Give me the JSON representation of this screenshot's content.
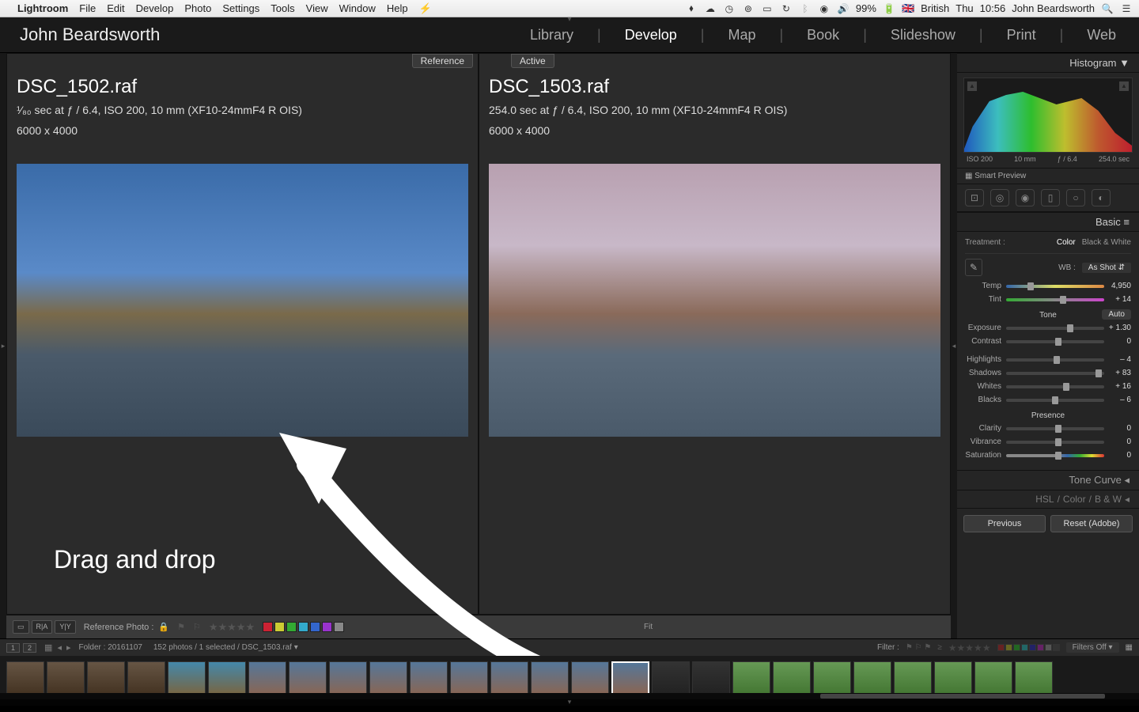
{
  "menubar": {
    "app": "Lightroom",
    "items": [
      "File",
      "Edit",
      "Develop",
      "Photo",
      "Settings",
      "Tools",
      "View",
      "Window",
      "Help"
    ],
    "battery": "99%",
    "lang_flag": "🇬🇧",
    "lang": "British",
    "day": "Thu",
    "time": "10:56",
    "user": "John Beardsworth"
  },
  "header": {
    "identity": "John Beardsworth",
    "modules": [
      "Library",
      "Develop",
      "Map",
      "Book",
      "Slideshow",
      "Print",
      "Web"
    ],
    "active_module": "Develop"
  },
  "compare": {
    "ref_badge": "Reference",
    "act_badge": "Active",
    "ref": {
      "filename": "DSC_1502.raf",
      "meta1": "¹⁄₈₀ sec at ƒ / 6.4, ISO 200, 10 mm (XF10-24mmF4 R OIS)",
      "meta2": "6000 x 4000"
    },
    "act": {
      "filename": "DSC_1503.raf",
      "meta1": "254.0 sec at ƒ / 6.4, ISO 200, 10 mm (XF10-24mmF4 R OIS)",
      "meta2": "6000 x 4000"
    },
    "annotation": "Drag and drop"
  },
  "right": {
    "hist_title": "Histogram",
    "hist_info": {
      "iso": "ISO 200",
      "focal": "10 mm",
      "aperture": "ƒ / 6.4",
      "shutter": "254.0 sec"
    },
    "smart_preview": "Smart Preview",
    "basic_title": "Basic",
    "treatment_label": "Treatment :",
    "treatment_tabs": {
      "color": "Color",
      "bw": "Black & White"
    },
    "wb_label": "WB :",
    "wb_value": "As Shot",
    "sliders": {
      "temp": {
        "label": "Temp",
        "value": "4,950",
        "pos": 22
      },
      "tint": {
        "label": "Tint",
        "value": "+ 14",
        "pos": 55
      },
      "exposure": {
        "label": "Exposure",
        "value": "+ 1.30",
        "pos": 62
      },
      "contrast": {
        "label": "Contrast",
        "value": "0",
        "pos": 50
      },
      "highlights": {
        "label": "Highlights",
        "value": "– 4",
        "pos": 48
      },
      "shadows": {
        "label": "Shadows",
        "value": "+ 83",
        "pos": 91
      },
      "whites": {
        "label": "Whites",
        "value": "+ 16",
        "pos": 58
      },
      "blacks": {
        "label": "Blacks",
        "value": "– 6",
        "pos": 47
      },
      "clarity": {
        "label": "Clarity",
        "value": "0",
        "pos": 50
      },
      "vibrance": {
        "label": "Vibrance",
        "value": "0",
        "pos": 50
      },
      "saturation": {
        "label": "Saturation",
        "value": "0",
        "pos": 50
      }
    },
    "tone_label": "Tone",
    "auto_label": "Auto",
    "presence_label": "Presence",
    "tone_curve": "Tone Curve",
    "hsl": {
      "hsl": "HSL",
      "color": "Color",
      "bw": "B & W"
    },
    "previous_btn": "Previous",
    "reset_btn": "Reset (Adobe)"
  },
  "toolbar": {
    "ra": "R|A",
    "yy": "Y|Y",
    "ref_label": "Reference Photo :",
    "fit": "Fit",
    "colors": [
      "#c23",
      "#cc3",
      "#3a3",
      "#3ac",
      "#36c",
      "#93c",
      "#888"
    ]
  },
  "filmstrip_header": {
    "mon1": "1",
    "mon2": "2",
    "path_label": "Folder :",
    "path_value": "20161107",
    "count": "152 photos / 1 selected /",
    "selected_file": "DSC_1503.raf",
    "filter_label": "Filter :",
    "filters_off": "Filters Off"
  }
}
